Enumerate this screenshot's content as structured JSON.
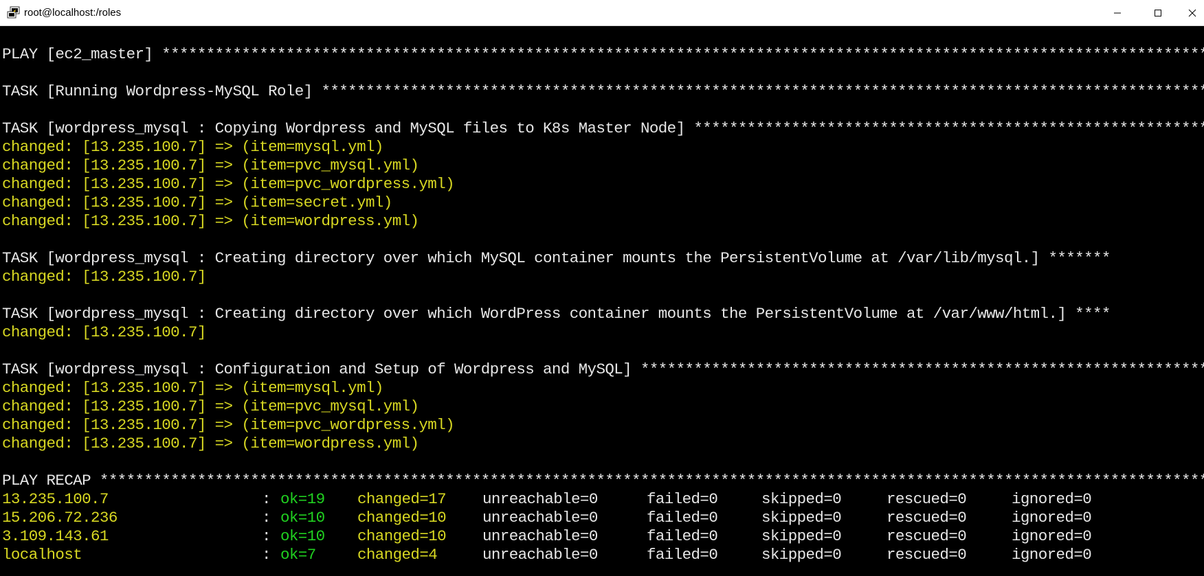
{
  "window": {
    "title": "root@localhost:/roles",
    "icons": [
      "putty-icon",
      "minimize-icon",
      "maximize-icon",
      "close-icon"
    ]
  },
  "colors": {
    "background": "#000000",
    "text": "#e6e6e6",
    "changed": "#d7d722",
    "ok": "#20d020"
  },
  "terminal": {
    "lines": [
      {
        "color": "w",
        "text": "PLAY [ec2_master] *************************************************************************************************************************"
      },
      {
        "color": "w",
        "text": "TASK [Running Wordpress-MySQL Role] *******************************************************************************************************"
      },
      {
        "color": "w",
        "text": "TASK [wordpress_mysql : Copying Wordpress and MySQL files to K8s Master Node] *************************************************************"
      },
      {
        "color": "y",
        "text": "changed: [13.235.100.7] => (item=mysql.yml)"
      },
      {
        "color": "y",
        "text": "changed: [13.235.100.7] => (item=pvc_mysql.yml)"
      },
      {
        "color": "y",
        "text": "changed: [13.235.100.7] => (item=pvc_wordpress.yml)"
      },
      {
        "color": "y",
        "text": "changed: [13.235.100.7] => (item=secret.yml)"
      },
      {
        "color": "y",
        "text": "changed: [13.235.100.7] => (item=wordpress.yml)"
      },
      {
        "color": "w",
        "text": "TASK [wordpress_mysql : Creating directory over which MySQL container mounts the PersistentVolume at /var/lib/mysql.] *******"
      },
      {
        "color": "y",
        "text": "changed: [13.235.100.7]"
      },
      {
        "color": "w",
        "text": "TASK [wordpress_mysql : Creating directory over which WordPress container mounts the PersistentVolume at /var/www/html.] ****"
      },
      {
        "color": "y",
        "text": "changed: [13.235.100.7]"
      },
      {
        "color": "w",
        "text": "TASK [wordpress_mysql : Configuration and Setup of Wordpress and MySQL] ******************************************************************"
      },
      {
        "color": "y",
        "text": "changed: [13.235.100.7] => (item=mysql.yml)"
      },
      {
        "color": "y",
        "text": "changed: [13.235.100.7] => (item=pvc_mysql.yml)"
      },
      {
        "color": "y",
        "text": "changed: [13.235.100.7] => (item=pvc_wordpress.yml)"
      },
      {
        "color": "y",
        "text": "changed: [13.235.100.7] => (item=wordpress.yml)"
      },
      {
        "color": "w",
        "text": "PLAY RECAP ********************************************************************************************************************************"
      }
    ],
    "recap": [
      {
        "host": "13.235.100.7",
        "sep": ":",
        "ok": "ok=19",
        "changed": "changed=17",
        "unreachable": "unreachable=0",
        "failed": "failed=0",
        "skipped": "skipped=0",
        "rescued": "rescued=0",
        "ignored": "ignored=0"
      },
      {
        "host": "15.206.72.236",
        "sep": ":",
        "ok": "ok=10",
        "changed": "changed=10",
        "unreachable": "unreachable=0",
        "failed": "failed=0",
        "skipped": "skipped=0",
        "rescued": "rescued=0",
        "ignored": "ignored=0"
      },
      {
        "host": "3.109.143.61",
        "sep": ":",
        "ok": "ok=10",
        "changed": "changed=10",
        "unreachable": "unreachable=0",
        "failed": "failed=0",
        "skipped": "skipped=0",
        "rescued": "rescued=0",
        "ignored": "ignored=0"
      },
      {
        "host": "localhost",
        "sep": ":",
        "ok": "ok=7",
        "changed": "changed=4",
        "unreachable": "unreachable=0",
        "failed": "failed=0",
        "skipped": "skipped=0",
        "rescued": "rescued=0",
        "ignored": "ignored=0"
      }
    ]
  }
}
